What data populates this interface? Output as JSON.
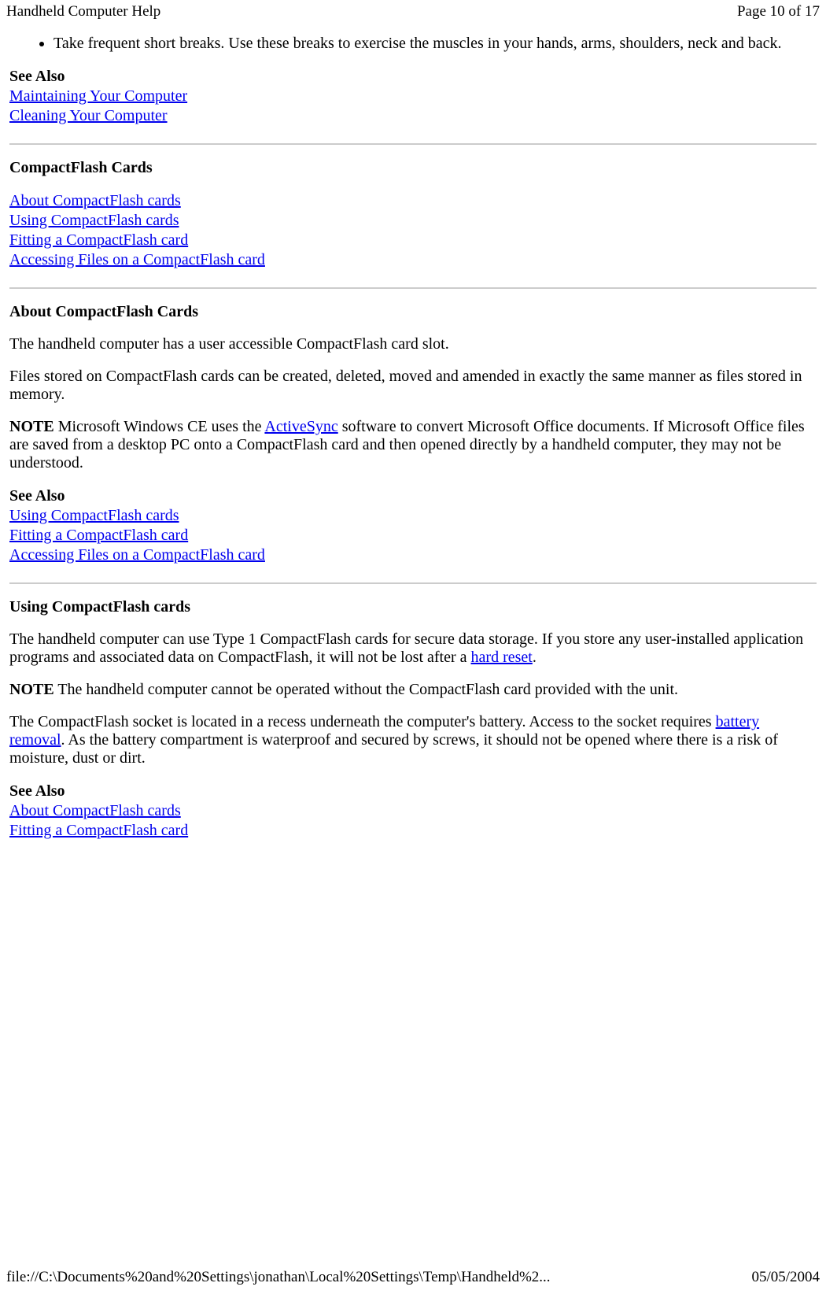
{
  "header": {
    "title": "Handheld Computer Help",
    "page_info": "Page 10 of 17"
  },
  "bullet1": "Take frequent short breaks. Use these breaks to exercise the muscles in your hands, arms, shoulders, neck and back.",
  "see_also_label": "See Also",
  "see_also_1": {
    "link1": "Maintaining Your Computer",
    "link2": "Cleaning Your Computer"
  },
  "cf_heading": "CompactFlash Cards",
  "cf_links": {
    "l1": "About CompactFlash cards",
    "l2": "Using CompactFlash cards",
    "l3": "Fitting a CompactFlash card",
    "l4": "Accessing Files on a CompactFlash card"
  },
  "about_heading": "About CompactFlash Cards",
  "about_p1": "The handheld computer has a user accessible CompactFlash card slot.",
  "about_p2": "Files stored on CompactFlash cards can be created, deleted, moved and amended in exactly the same manner as files stored in memory.",
  "note_label": "NOTE",
  "about_note_pre": " Microsoft Windows CE uses the ",
  "about_note_link": "ActiveSync",
  "about_note_post": " software to convert Microsoft Office documents. If Microsoft Office files are saved from a desktop PC onto a CompactFlash card and then opened directly by a handheld computer, they may not be understood.",
  "see_also_2": {
    "l1": "Using CompactFlash cards",
    "l2": "Fitting a CompactFlash card",
    "l3": "Accessing Files on a CompactFlash card"
  },
  "using_heading": "Using CompactFlash cards",
  "using_p1_pre": "The handheld computer can use Type 1 CompactFlash cards for secure data storage. If you store any user-installed application programs and associated data on CompactFlash, it will not be lost after a ",
  "using_p1_link": "hard reset",
  "using_p1_post": ".",
  "using_note": "  The handheld computer cannot be operated without the CompactFlash card provided with the unit.",
  "using_p2_pre": "The CompactFlash socket is located in a recess underneath the computer's battery. Access to the socket requires ",
  "using_p2_link": "battery removal",
  "using_p2_post": ". As the battery compartment is waterproof and secured by screws, it should not be opened where there is a risk of moisture, dust or dirt.",
  "see_also_3": {
    "l1": "About CompactFlash cards",
    "l2": "Fitting a CompactFlash card"
  },
  "footer": {
    "path": "file://C:\\Documents%20and%20Settings\\jonathan\\Local%20Settings\\Temp\\Handheld%2...",
    "date": "05/05/2004"
  }
}
